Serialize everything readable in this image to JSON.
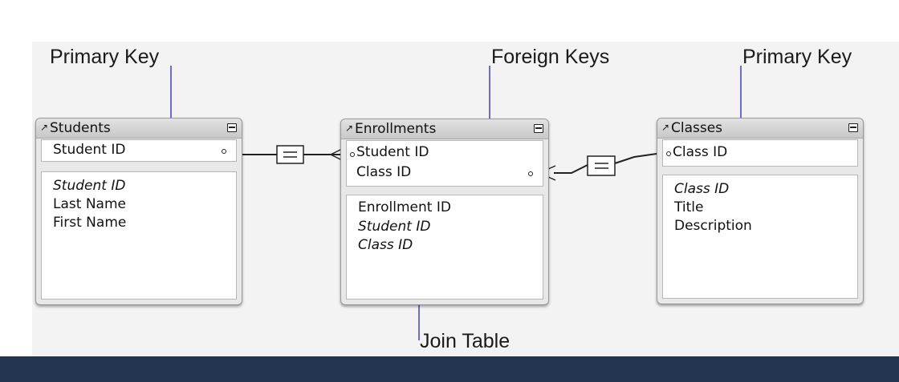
{
  "callouts": {
    "primary_key_left": "Primary Key",
    "foreign_keys": "Foreign Keys",
    "primary_key_right": "Primary Key",
    "join_table": "Join Table"
  },
  "tables": {
    "students": {
      "title": "Students",
      "keys": [
        "Student ID"
      ],
      "fields": [
        {
          "name": "Student ID",
          "italic": true
        },
        {
          "name": "Last Name",
          "italic": false
        },
        {
          "name": "First Name",
          "italic": false
        }
      ]
    },
    "enrollments": {
      "title": "Enrollments",
      "keys": [
        "Student ID",
        "Class ID"
      ],
      "fields": [
        {
          "name": "Enrollment ID",
          "italic": false
        },
        {
          "name": "Student ID",
          "italic": true
        },
        {
          "name": "Class ID",
          "italic": true
        }
      ]
    },
    "classes": {
      "title": "Classes",
      "keys": [
        "Class ID"
      ],
      "fields": [
        {
          "name": "Class ID",
          "italic": true
        },
        {
          "name": "Title",
          "italic": false
        },
        {
          "name": "Description",
          "italic": false
        }
      ]
    }
  },
  "colors": {
    "callout_line": "#4a4ac8",
    "bottom_bar": "#24364f",
    "pane": "#f3f3f3"
  },
  "icons": [
    "table-arrow-icon",
    "collapse-icon",
    "equals-operator-icon",
    "crows-foot-icon",
    "key-dot-icon"
  ]
}
